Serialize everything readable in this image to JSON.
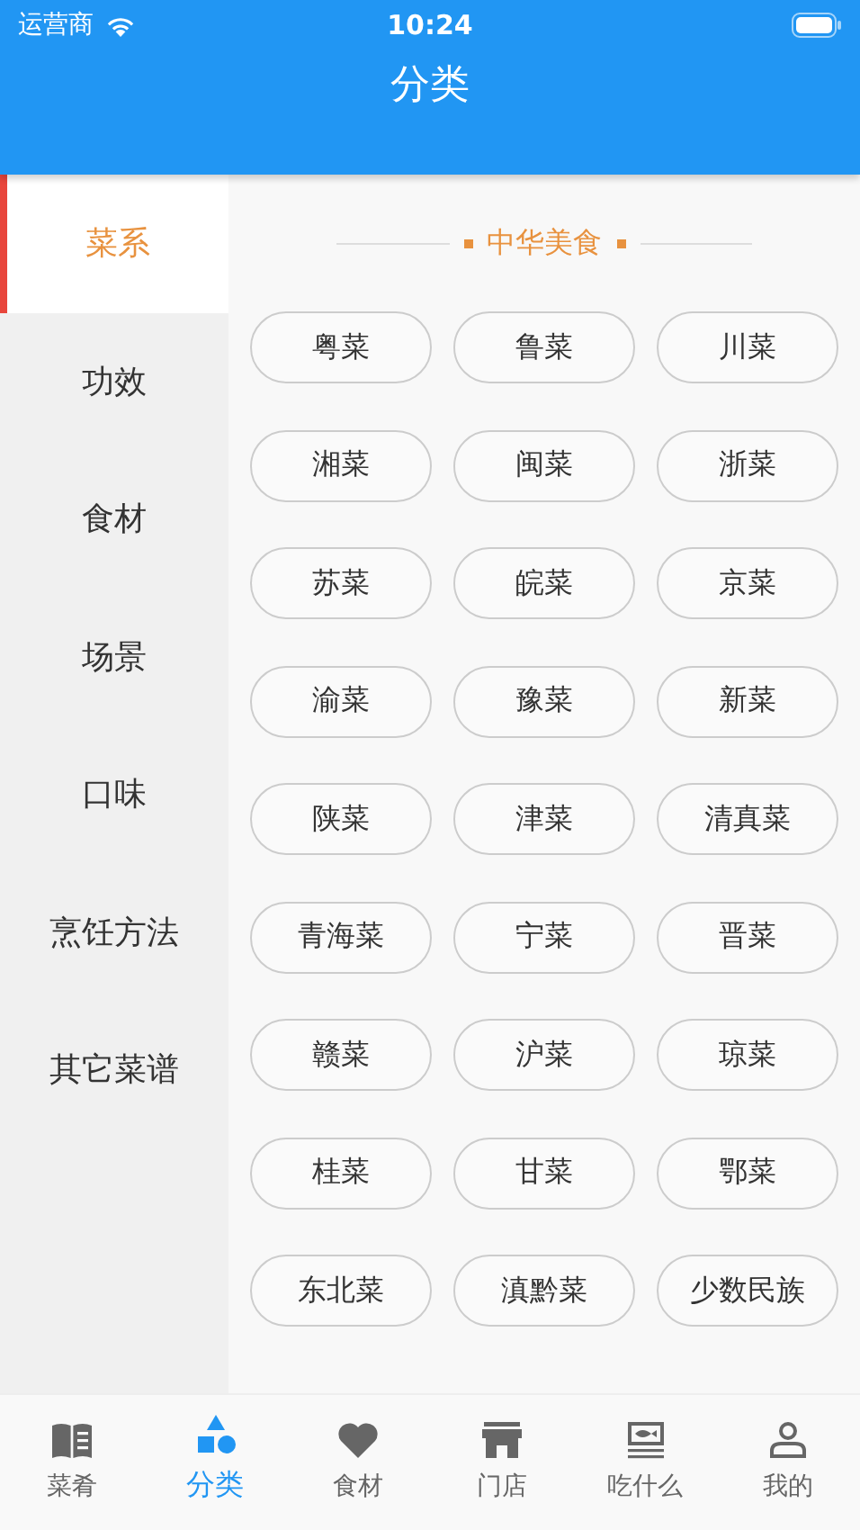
{
  "status_bar": {
    "carrier": "运营商",
    "time": "10:24"
  },
  "header": {
    "title": "分类"
  },
  "sidebar": {
    "items": [
      {
        "label": "菜系",
        "selected": true
      },
      {
        "label": "功效",
        "selected": false
      },
      {
        "label": "食材",
        "selected": false
      },
      {
        "label": "场景",
        "selected": false
      },
      {
        "label": "口味",
        "selected": false
      },
      {
        "label": "烹饪方法",
        "selected": false
      },
      {
        "label": "其它菜谱",
        "selected": false
      }
    ]
  },
  "section": {
    "title": "中华美食",
    "tags": [
      "粤菜",
      "鲁菜",
      "川菜",
      "湘菜",
      "闽菜",
      "浙菜",
      "苏菜",
      "皖菜",
      "京菜",
      "渝菜",
      "豫菜",
      "新菜",
      "陕菜",
      "津菜",
      "清真菜",
      "青海菜",
      "宁菜",
      "晋菜",
      "赣菜",
      "沪菜",
      "琼菜",
      "桂菜",
      "甘菜",
      "鄂菜",
      "东北菜",
      "滇黔菜",
      "少数民族"
    ]
  },
  "tab_bar": {
    "items": [
      {
        "label": "菜肴",
        "selected": false
      },
      {
        "label": "分类",
        "selected": true
      },
      {
        "label": "食材",
        "selected": false
      },
      {
        "label": "门店",
        "selected": false
      },
      {
        "label": "吃什么",
        "selected": false
      },
      {
        "label": "我的",
        "selected": false
      }
    ]
  }
}
